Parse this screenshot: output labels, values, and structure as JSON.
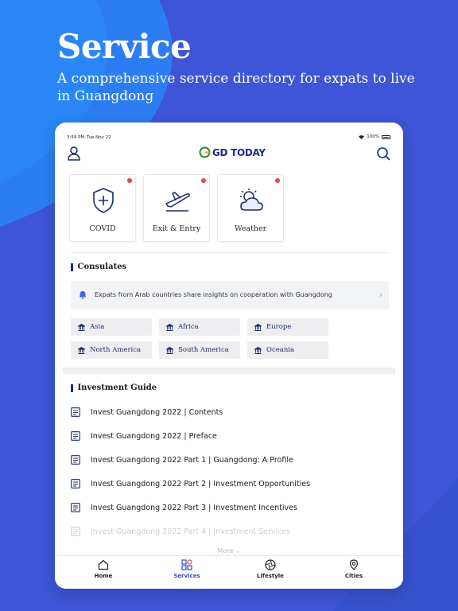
{
  "hero": {
    "title": "Service",
    "subtitle": "A comprehensive service directory for expats to live in Guangdong"
  },
  "status_bar": {
    "time": "3:59 PM",
    "date": "Tue Nov 22",
    "battery": "100%"
  },
  "app_bar": {
    "logo_text": "GD TODAY",
    "icons": [
      "user-icon",
      "search-icon"
    ]
  },
  "services": [
    {
      "label": "COVID",
      "icon": "shield-plus-icon",
      "has_badge": true
    },
    {
      "label": "Exit & Entry",
      "icon": "airplane-icon",
      "has_badge": true
    },
    {
      "label": "Weather",
      "icon": "cloud-sun-icon",
      "has_badge": true
    }
  ],
  "consulates": {
    "title": "Consulates",
    "notice": "Expats from Arab countries share insights on cooperation with Guangdong",
    "regions": [
      "Asia",
      "Africa",
      "Europe",
      "North America",
      "South America",
      "Oceania"
    ]
  },
  "investment_guide": {
    "title": "Investment Guide",
    "items": [
      "Invest Guangdong 2022 | Contents",
      "Invest Guangdong 2022 | Preface",
      "Invest Guangdong 2022 Part 1 | Guangdong: A Profile",
      "Invest Guangdong 2022 Part 2 | Investment Opportunities",
      "Invest Guangdong 2022 Part 3 | Investment Incentives",
      "Invest Guangdong 2022 Part 4 | Investment Services"
    ],
    "more_label": "More"
  },
  "tabs": [
    {
      "label": "Home",
      "icon": "home-icon",
      "active": false
    },
    {
      "label": "Services",
      "icon": "services-grid-icon",
      "active": true
    },
    {
      "label": "Lifestyle",
      "icon": "aperture-icon",
      "active": false
    },
    {
      "label": "Cities",
      "icon": "location-pin-icon",
      "active": false
    }
  ],
  "colors": {
    "background": "#3d55d6",
    "brand_navy": "#1c2a8a",
    "active_tab": "#2f48c8",
    "badge": "#e8483f"
  }
}
